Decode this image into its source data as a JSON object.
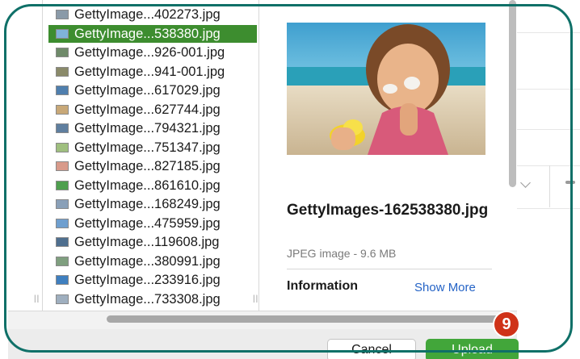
{
  "files": [
    {
      "name": "GettyImage...402273.jpg",
      "selected": false,
      "thumb": "#8a9aa8"
    },
    {
      "name": "GettyImage...538380.jpg",
      "selected": true,
      "thumb": "#7fb3d8"
    },
    {
      "name": "GettyImage...926-001.jpg",
      "selected": false,
      "thumb": "#6f8a6a"
    },
    {
      "name": "GettyImage...941-001.jpg",
      "selected": false,
      "thumb": "#8a8a6a"
    },
    {
      "name": "GettyImage...617029.jpg",
      "selected": false,
      "thumb": "#4f7fae"
    },
    {
      "name": "GettyImage...627744.jpg",
      "selected": false,
      "thumb": "#c8a878"
    },
    {
      "name": "GettyImage...794321.jpg",
      "selected": false,
      "thumb": "#5f7f9f"
    },
    {
      "name": "GettyImage...751347.jpg",
      "selected": false,
      "thumb": "#9fbf7f"
    },
    {
      "name": "GettyImage...827185.jpg",
      "selected": false,
      "thumb": "#d89a8a"
    },
    {
      "name": "GettyImage...861610.jpg",
      "selected": false,
      "thumb": "#4f9f4f"
    },
    {
      "name": "GettyImage...168249.jpg",
      "selected": false,
      "thumb": "#8aa0b8"
    },
    {
      "name": "GettyImage...475959.jpg",
      "selected": false,
      "thumb": "#6f9fcf"
    },
    {
      "name": "GettyImage...119608.jpg",
      "selected": false,
      "thumb": "#4f6f8f"
    },
    {
      "name": "GettyImage...380991.jpg",
      "selected": false,
      "thumb": "#7f9f7f"
    },
    {
      "name": "GettyImage...233916.jpg",
      "selected": false,
      "thumb": "#3f7fbf"
    },
    {
      "name": "GettyImage...733308.jpg",
      "selected": false,
      "thumb": "#9fafbf"
    }
  ],
  "preview": {
    "filename": "GettyImages-162538380.jpg",
    "subtitle": "JPEG image - 9.6 MB",
    "info_heading": "Information",
    "show_more": "Show More"
  },
  "buttons": {
    "cancel": "Cancel",
    "upload": "Upload"
  },
  "step_badge": "9",
  "colors": {
    "accent_green": "#42a63a",
    "selection": "#3d8d2f",
    "link_blue": "#2463c6",
    "badge_red": "#cf3218",
    "callout_teal": "#0f7068"
  }
}
